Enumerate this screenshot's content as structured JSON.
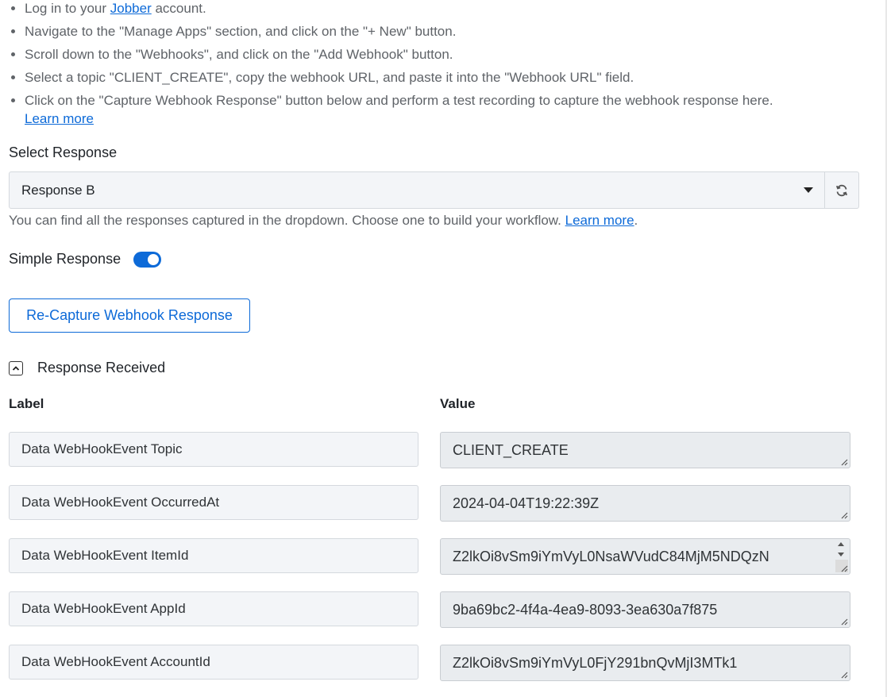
{
  "instructions": {
    "step1_before": "Log in to your ",
    "step1_link": "Jobber",
    "step1_after": " account.",
    "step2": "Navigate to the \"Manage Apps\" section, and click on the \"+ New\" button.",
    "step3": "Scroll down to the \"Webhooks\", and click on the \"Add Webhook\" button.",
    "step4": "Select a topic \"CLIENT_CREATE\", copy the webhook URL, and paste it into the \"Webhook URL\" field.",
    "step5": "Click on the \"Capture Webhook Response\" button below and perform a test recording to capture the webhook response here.",
    "step5_link": "Learn more"
  },
  "select_response": {
    "label": "Select Response",
    "selected": "Response B",
    "helper_text": "You can find all the responses captured in the dropdown. Choose one to build your workflow. ",
    "helper_link": "Learn more",
    "helper_end": ".",
    "refresh_icon": "refresh-icon"
  },
  "simple_response": {
    "label": "Simple Response",
    "enabled": true
  },
  "recapture_button": "Re-Capture Webhook Response",
  "response_received": {
    "title": "Response Received",
    "icon": "chevron-up-icon",
    "label_header": "Label",
    "value_header": "Value",
    "rows": [
      {
        "label": "Data WebHookEvent Topic",
        "value": "CLIENT_CREATE"
      },
      {
        "label": "Data WebHookEvent OccurredAt",
        "value": "2024-04-04T19:22:39Z"
      },
      {
        "label": "Data WebHookEvent ItemId",
        "value": "Z2lkOi8vSm9iYmVyL0NsaWVudC84MjM5NDQzN"
      },
      {
        "label": "Data WebHookEvent AppId",
        "value": "9ba69bc2-4f4a-4ea9-8093-3ea630a7f875"
      },
      {
        "label": "Data WebHookEvent AccountId",
        "value": "Z2lkOi8vSm9iYmVyL0FjY291bnQvMjI3MTk1"
      }
    ]
  },
  "colors": {
    "accent": "#0d6ad8",
    "field_bg": "#f3f5f8",
    "readonly_bg": "#e9ecef"
  }
}
